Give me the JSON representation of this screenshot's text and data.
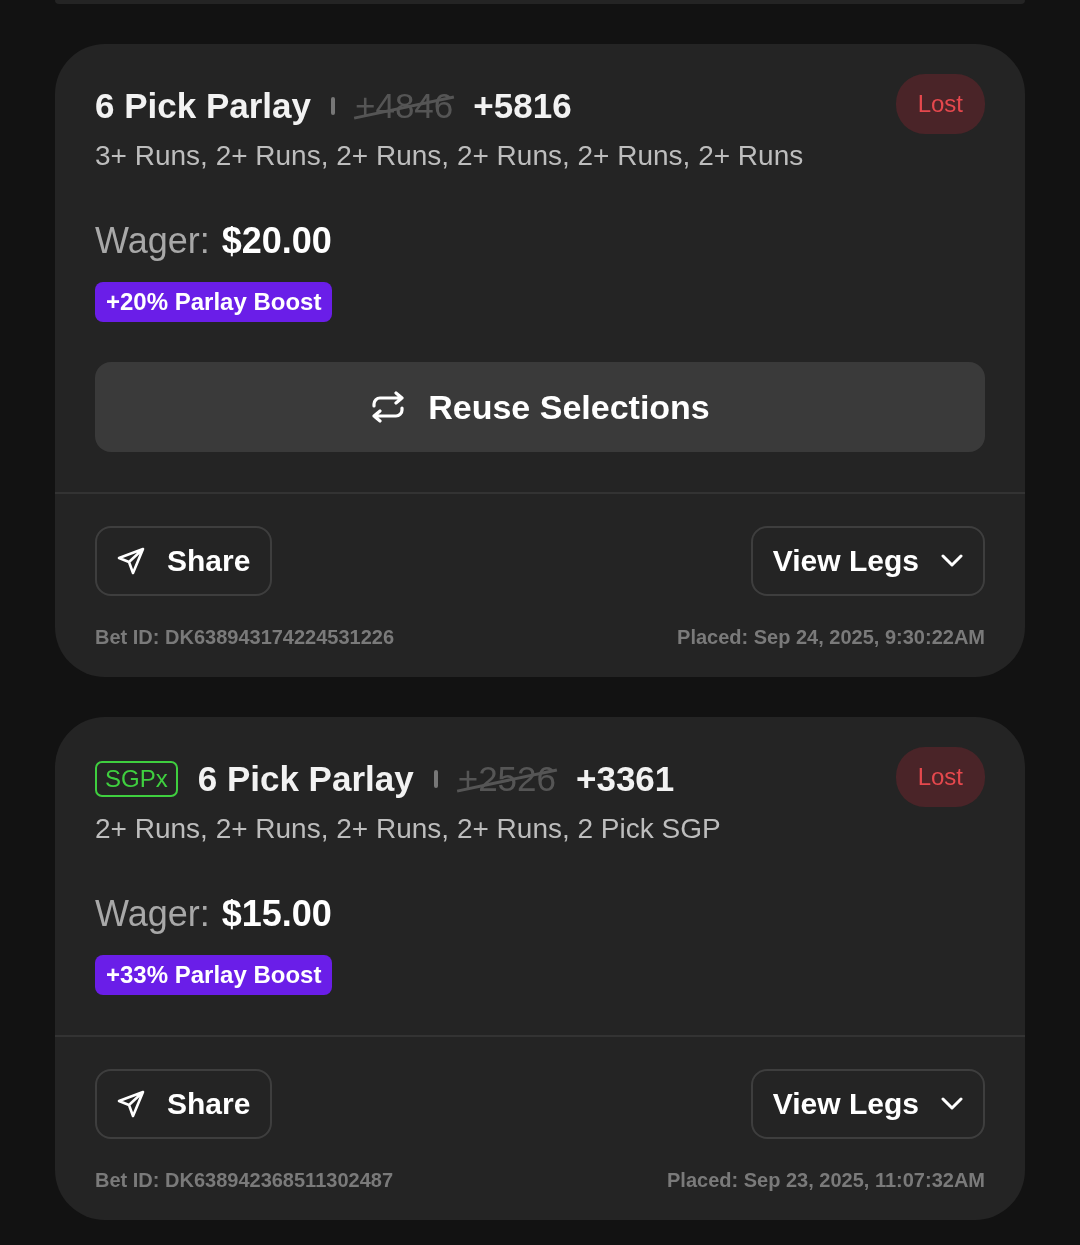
{
  "bets": [
    {
      "title": "6 Pick Parlay",
      "old_odds": "+4846",
      "odds": "+5816",
      "status": "Lost",
      "legs": "3+ Runs, 2+ Runs, 2+ Runs, 2+ Runs, 2+ Runs, 2+ Runs",
      "wager_label": "Wager:",
      "wager": "$20.00",
      "boost": "+20% Parlay Boost",
      "reuse_button": "Reuse Selections",
      "share": "Share",
      "view_legs": "View Legs",
      "bet_id": "Bet ID: DK638943174224531226",
      "placed": "Placed: Sep 24, 2025, 9:30:22AM"
    },
    {
      "tag": "SGPx",
      "title": "6 Pick Parlay",
      "old_odds": "+2526",
      "odds": "+3361",
      "status": "Lost",
      "legs": "2+ Runs, 2+ Runs, 2+ Runs, 2+ Runs, 2 Pick SGP",
      "wager_label": "Wager:",
      "wager": "$15.00",
      "boost": "+33% Parlay Boost",
      "share": "Share",
      "view_legs": "View Legs",
      "bet_id": "Bet ID: DK638942368511302487",
      "placed": "Placed: Sep 23, 2025, 11:07:32AM"
    }
  ]
}
